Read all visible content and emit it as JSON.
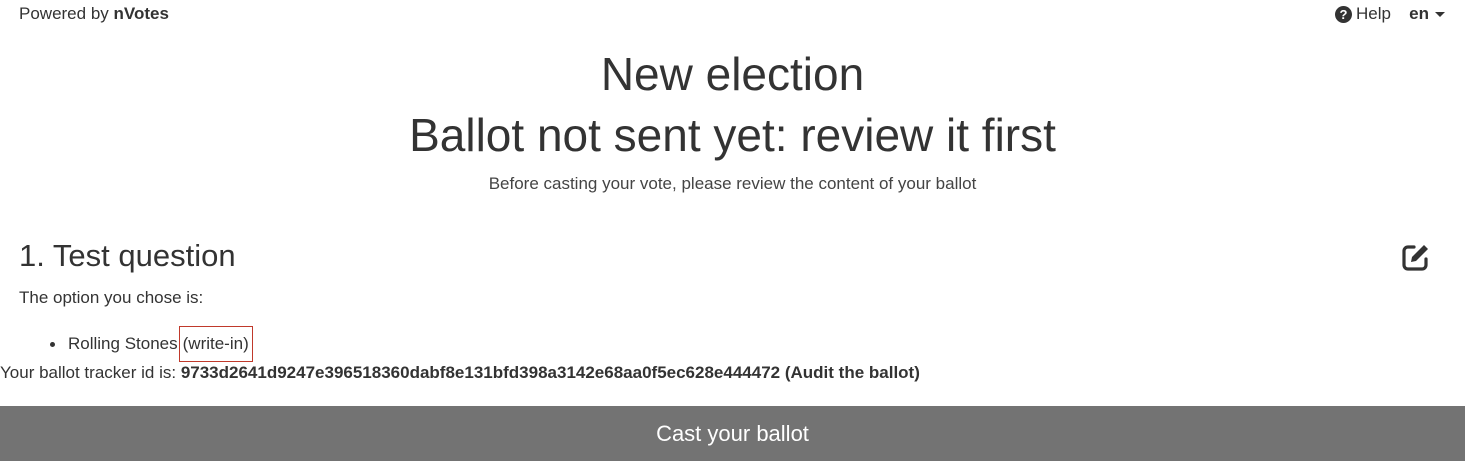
{
  "header": {
    "powered_prefix": "Powered by",
    "powered_brand": "nVotes",
    "help_label": "Help",
    "help_icon": "question-circle-icon",
    "language": "en"
  },
  "main": {
    "title": "New election",
    "subtitle": "Ballot not sent yet: review it first",
    "description": "Before casting your vote, please review the content of your ballot"
  },
  "question": {
    "heading": "1. Test question",
    "edit_icon": "edit-icon",
    "chose_label": "The option you chose is:",
    "options": [
      {
        "text": "Rolling Stones",
        "tag": "(write-in)"
      }
    ]
  },
  "tracker": {
    "label": "Your ballot tracker id is:",
    "id": "9733d2641d9247e396518360dabf8e131bfd398a3142e68aa0f5ec628e444472",
    "audit_label": "(Audit the ballot)"
  },
  "footer": {
    "cast_label": "Cast your ballot",
    "cast_color": "#737373"
  }
}
